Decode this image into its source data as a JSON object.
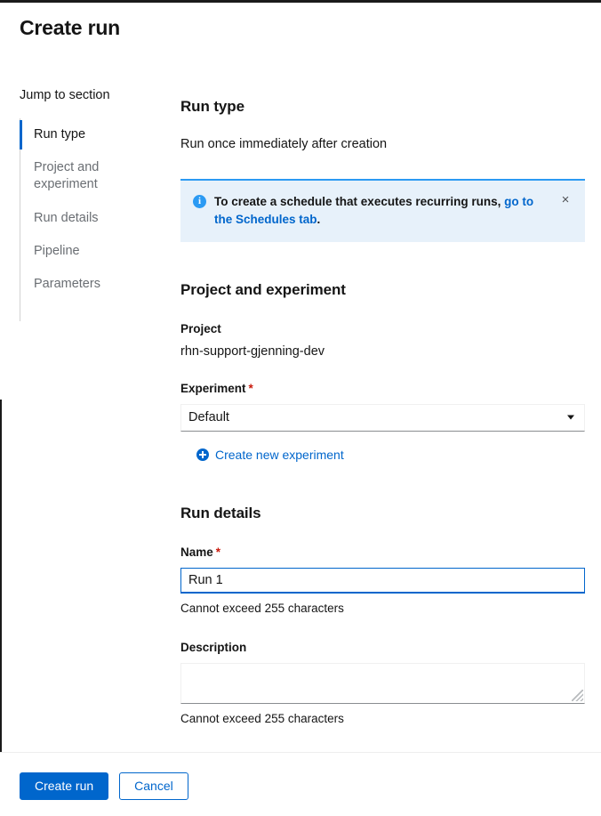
{
  "page": {
    "title": "Create run"
  },
  "jump_nav": {
    "heading": "Jump to section",
    "items": [
      {
        "label": "Run type",
        "active": true
      },
      {
        "label": "Project and experiment",
        "active": false
      },
      {
        "label": "Run details",
        "active": false
      },
      {
        "label": "Pipeline",
        "active": false
      },
      {
        "label": "Parameters",
        "active": false
      }
    ]
  },
  "run_type": {
    "heading": "Run type",
    "description": "Run once immediately after creation"
  },
  "alert": {
    "icon": "info-circle-icon",
    "text_before_link": "To create a schedule that executes recurring runs, ",
    "link_text": "go to the Schedules tab",
    "text_after_link": ".",
    "close_label": "×",
    "accent_color": "#2b9af3",
    "background_color": "#e7f1fa"
  },
  "project_and_experiment": {
    "heading": "Project and experiment",
    "project_label": "Project",
    "project_value": "rhn-support-gjenning-dev",
    "experiment_label": "Experiment",
    "required_marker": "*",
    "experiment_selected": "Default",
    "create_experiment_link": "Create new experiment"
  },
  "run_details": {
    "heading": "Run details",
    "name_label": "Name",
    "name_required_marker": "*",
    "name_value": "Run 1",
    "name_placeholder": "",
    "name_help": "Cannot exceed 255 characters",
    "description_label": "Description",
    "description_value": "",
    "description_placeholder": "",
    "description_help": "Cannot exceed 255 characters"
  },
  "footer": {
    "primary_label": "Create run",
    "secondary_label": "Cancel",
    "primary_color": "#0066cc"
  }
}
